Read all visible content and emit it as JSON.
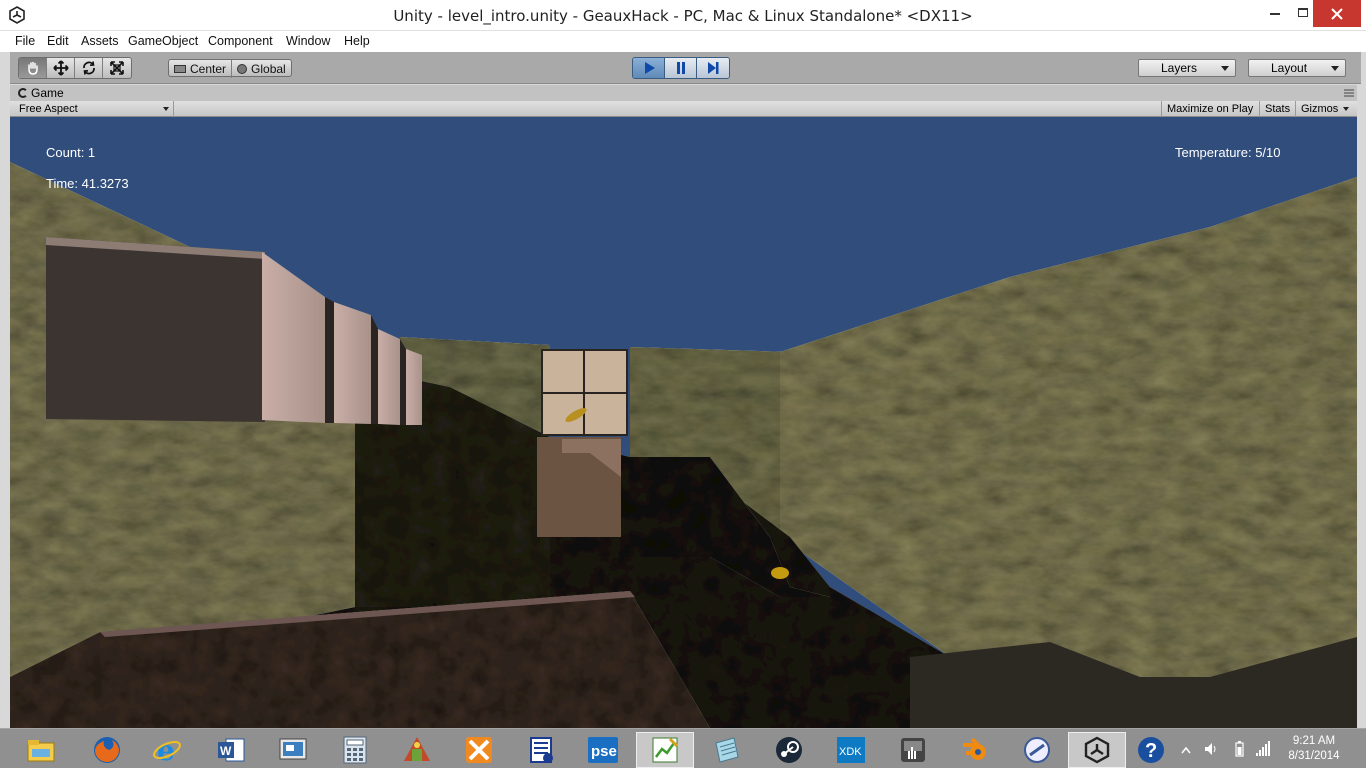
{
  "window": {
    "title": "Unity - level_intro.unity - GeauxHack - PC, Mac & Linux Standalone* <DX11>"
  },
  "menu": {
    "file": "File",
    "edit": "Edit",
    "assets": "Assets",
    "gameobject": "GameObject",
    "component": "Component",
    "window": "Window",
    "help": "Help"
  },
  "toolbar": {
    "tools": [
      "hand-icon",
      "move-icon",
      "rotate-icon",
      "scale-icon"
    ],
    "pivot_center": "Center",
    "pivot_global": "Global",
    "layers": "Layers",
    "layout": "Layout",
    "play_state": "playing"
  },
  "panel": {
    "tab": "Game",
    "aspect": "Free Aspect",
    "maximize_on_play": "Maximize on Play",
    "stats": "Stats",
    "gizmos": "Gizmos"
  },
  "hud": {
    "count": "Count: 1",
    "time": "Time: 41.3273",
    "temperature": "Temperature: 5/10"
  },
  "colors": {
    "sky": "#304d7c",
    "play_accent": "#5f89b8",
    "close_button": "#c7372f",
    "taskbar": "#909090"
  },
  "taskbar": {
    "apps": [
      "file-explorer-icon",
      "firefox-icon",
      "internet-explorer-icon",
      "word-icon",
      "remote-desktop-icon",
      "calculator-icon",
      "game-app-icon",
      "xsplit-icon",
      "network-icon",
      "photoshop-elements-icon",
      "project-icon",
      "notepad-icon",
      "steam-icon",
      "intel-xdk-icon",
      "touch-app-icon",
      "blender-icon",
      "remote-app-icon",
      "unity-icon",
      "help-icon"
    ],
    "xdk_label": "XDK",
    "pse_label": "pse",
    "time": "9:21 AM",
    "date": "8/31/2014"
  }
}
